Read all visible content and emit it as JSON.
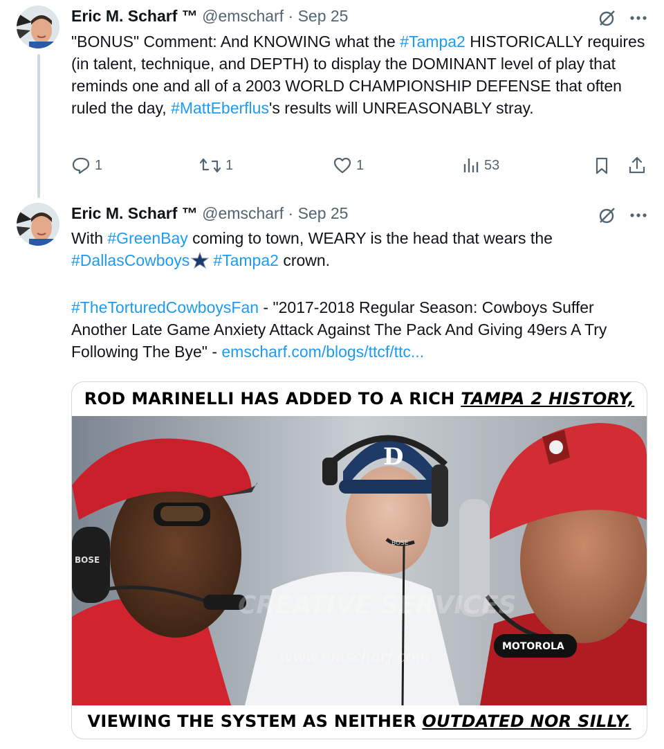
{
  "tweets": [
    {
      "name": "Eric M. Scharf ™",
      "handle": "@emscharf",
      "separator": "·",
      "date": "Sep 25",
      "text_parts": [
        {
          "t": "\"BONUS\" Comment: And KNOWING what the ",
          "k": "text"
        },
        {
          "t": "#Tampa2",
          "k": "tag"
        },
        {
          "t": " HISTORICALLY requires (in talent, technique, and DEPTH) to display the DOMINANT level of play that reminds one and all of a 2003 WORLD CHAMPIONSHIP DEFENSE that often ruled the day, ",
          "k": "text"
        },
        {
          "t": "#MattEberflus",
          "k": "tag"
        },
        {
          "t": "'s results will UNREASONABLY stray.",
          "k": "text"
        }
      ],
      "actions": {
        "replies": "1",
        "reposts": "1",
        "likes": "1",
        "views": "53"
      }
    },
    {
      "name": "Eric M. Scharf ™",
      "handle": "@emscharf",
      "separator": "·",
      "date": "Sep 25",
      "line1_a": "With ",
      "line1_tag": "#GreenBay",
      "line1_b": " coming to town, WEARY is the head that wears the",
      "line2_tag1": "#DallasCowboys",
      "line2_tag2": "#Tampa2",
      "line2_b": " crown.",
      "para2_tag": "#TheTorturedCowboysFan",
      "para2_text": " - \"2017-2018 Regular Season: Cowboys Suffer Another Late Game Anxiety Attack Against The Pack And Giving 49ers A Try Following The Bye\" - ",
      "para2_link": "emscharf.com/blogs/ttcf/ttc..."
    }
  ],
  "media": {
    "caption_top_a": "ROD MARINELLI HAS ADDED TO A RICH ",
    "caption_top_b": "TAMPA 2 HISTORY,",
    "caption_bottom_a": "VIEWING THE SYSTEM AS NEITHER ",
    "caption_bottom_b": "OUTDATED NOR SILLY.",
    "headset_brand_left": "BOSE",
    "headset_brand_middle": "BOSE",
    "headset_brand_right": "MOTOROLA",
    "cap_letter": "D",
    "watermark": "www.emscharf.com",
    "watermark2": "CREATIVE SERVICES"
  },
  "colors": {
    "link": "#1d9bf0",
    "muted": "#536471",
    "thread_line": "#cfd9de"
  },
  "icons": [
    "grok-icon",
    "more-icon",
    "reply-icon",
    "repost-icon",
    "like-icon",
    "views-icon",
    "bookmark-icon",
    "share-icon",
    "star-icon"
  ]
}
